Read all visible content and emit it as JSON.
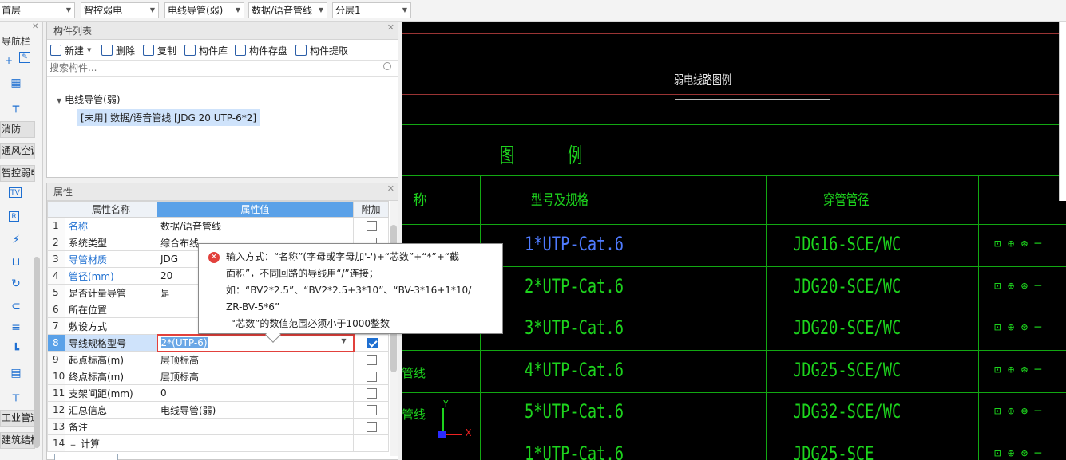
{
  "topbar": {
    "combos": [
      {
        "value": "首层"
      },
      {
        "value": "智控弱电"
      },
      {
        "value": "电线导管(弱)"
      },
      {
        "value": "数据/语音管线"
      },
      {
        "value": "分层1"
      }
    ]
  },
  "navbar": {
    "title": "导航栏",
    "categories": [
      "消防",
      "通风空调",
      "智控弱电",
      "工业管道",
      "建筑结构"
    ]
  },
  "component_list": {
    "title": "构件列表",
    "toolbar": {
      "new": "新建",
      "delete": "删除",
      "copy": "复制",
      "library": "构件库",
      "save": "构件存盘",
      "extract": "构件提取"
    },
    "search_placeholder": "搜索构件...",
    "tree": {
      "root": "电线导管(弱)",
      "child": "[未用] 数据/语音管线 [JDG 20 UTP-6*2]"
    }
  },
  "properties": {
    "title": "属性",
    "headers": {
      "name": "属性名称",
      "value": "属性值",
      "extra": "附加"
    },
    "rows": [
      {
        "n": "1",
        "name": "名称",
        "value": "数据/语音管线",
        "blue": true
      },
      {
        "n": "2",
        "name": "系统类型",
        "value": "综合布线"
      },
      {
        "n": "3",
        "name": "导管材质",
        "value": "JDG",
        "blue": true
      },
      {
        "n": "4",
        "name": "管径(mm)",
        "value": "20",
        "blue": true
      },
      {
        "n": "5",
        "name": "是否计量导管",
        "value": "是"
      },
      {
        "n": "6",
        "name": "所在位置",
        "value": ""
      },
      {
        "n": "7",
        "name": "敷设方式",
        "value": ""
      },
      {
        "n": "8",
        "name": "导线规格型号",
        "value": "2*(UTP-6)",
        "active": true
      },
      {
        "n": "9",
        "name": "起点标高(m)",
        "value": "层顶标高"
      },
      {
        "n": "10",
        "name": "终点标高(m)",
        "value": "层顶标高"
      },
      {
        "n": "11",
        "name": "支架间距(mm)",
        "value": "0"
      },
      {
        "n": "12",
        "name": "汇总信息",
        "value": "电线导管(弱)"
      },
      {
        "n": "13",
        "name": "备注",
        "value": ""
      },
      {
        "n": "14",
        "name": "计算",
        "value": ""
      }
    ]
  },
  "tooltip": {
    "line1": "输入方式：“名称”(字母或字母加'-')+“芯数”+“*”+“截",
    "line2": "面积”，不同回路的导线用“/”连接；",
    "line3": "如：“BV2*2.5”、“BV2*2.5+3*10”、“BV-3*16+1*10/",
    "line4": "ZR-BV-5*6”",
    "line5": "“芯数”的数值范围必须小于1000整数"
  },
  "cad": {
    "title": "弱电线路图例",
    "legend_heading": "图 例",
    "col_left": "称",
    "col_model": "型号及规格",
    "col_conduit": "穿管管径",
    "rows": [
      {
        "model": "1*UTP-Cat.6",
        "conduit": "JDG16-SCE/WC",
        "highlight": true
      },
      {
        "model": "2*UTP-Cat.6",
        "conduit": "JDG20-SCE/WC"
      },
      {
        "model": "3*UTP-Cat.6",
        "conduit": "JDG20-SCE/WC"
      },
      {
        "model": "4*UTP-Cat.6",
        "conduit": "JDG25-SCE/WC",
        "left": "管线"
      },
      {
        "model": "5*UTP-Cat.6",
        "conduit": "JDG32-SCE/WC",
        "left": "管线"
      },
      {
        "model": "1*UTP-Cat.6",
        "conduit": "JDG25-SCE"
      }
    ],
    "axis_x": "X",
    "axis_y": "Y"
  }
}
